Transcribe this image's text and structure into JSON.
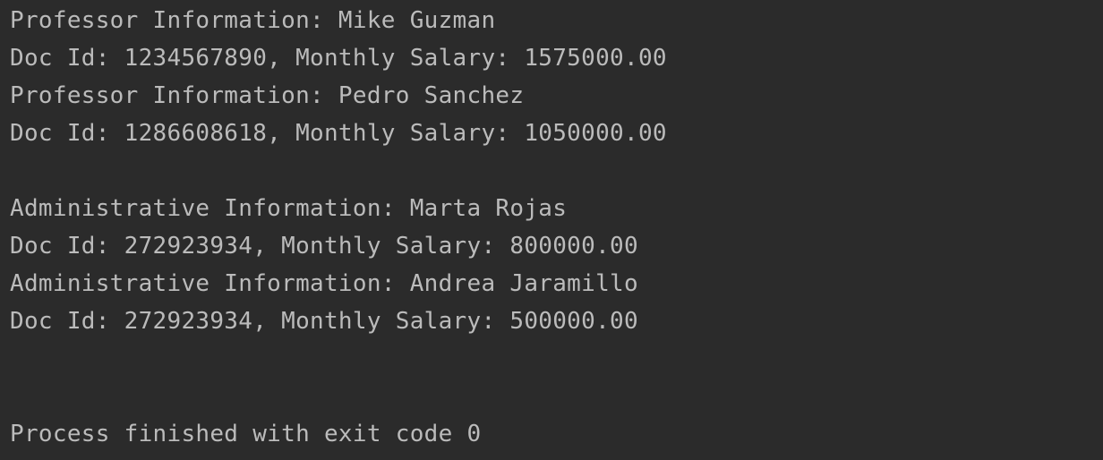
{
  "console": {
    "lines": [
      "Professor Information: Mike Guzman",
      "Doc Id: 1234567890, Monthly Salary: 1575000.00",
      "Professor Information: Pedro Sanchez",
      "Doc Id: 1286608618, Monthly Salary: 1050000.00",
      "",
      "Administrative Information: Marta Rojas",
      "Doc Id: 272923934, Monthly Salary: 800000.00",
      "Administrative Information: Andrea Jaramillo",
      "Doc Id: 272923934, Monthly Salary: 500000.00",
      "",
      "",
      "Process finished with exit code 0"
    ],
    "colors": {
      "background": "#2b2b2b",
      "text": "#bbbbbb"
    }
  }
}
